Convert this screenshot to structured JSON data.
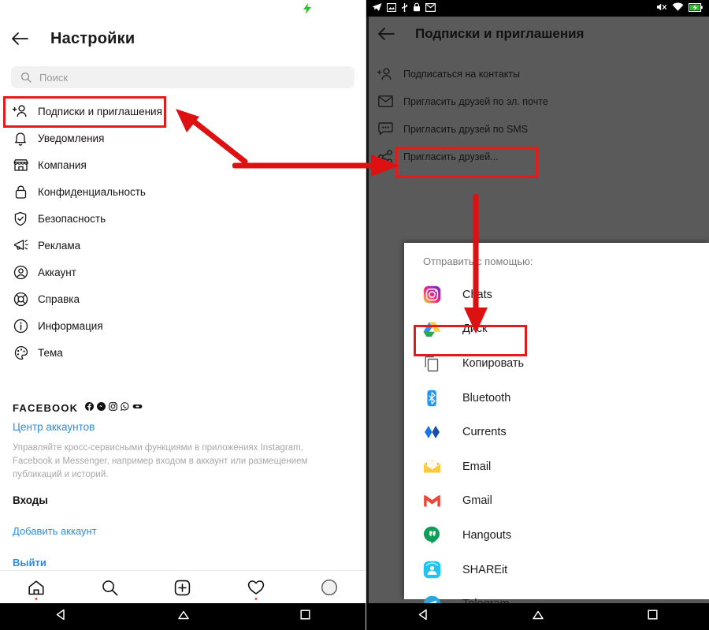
{
  "left_phone": {
    "status": {
      "charging_icon": "charging-bolt-icon"
    },
    "header": {
      "back_icon": "back-arrow-icon",
      "title": "Настройки"
    },
    "search": {
      "icon": "search-icon",
      "placeholder": "Поиск"
    },
    "menu_items": [
      {
        "icon": "follow-person-icon",
        "label": "Подписки и приглашения",
        "highlighted": true
      },
      {
        "icon": "bell-icon",
        "label": "Уведомления"
      },
      {
        "icon": "store-icon",
        "label": "Компания"
      },
      {
        "icon": "lock-icon",
        "label": "Конфиденциальность"
      },
      {
        "icon": "shield-check-icon",
        "label": "Безопасность"
      },
      {
        "icon": "megaphone-icon",
        "label": "Реклама"
      },
      {
        "icon": "account-circle-icon",
        "label": "Аккаунт"
      },
      {
        "icon": "lifebuoy-icon",
        "label": "Справка"
      },
      {
        "icon": "info-circle-icon",
        "label": "Информация"
      },
      {
        "icon": "palette-icon",
        "label": "Тема"
      }
    ],
    "facebook_section": {
      "word": "FACEBOOK",
      "brand_icons": [
        "facebook-icon",
        "messenger-icon",
        "instagram-icon",
        "whatsapp-icon",
        "oculus-icon"
      ],
      "link": "Центр аккаунтов",
      "description": "Управляйте кросс-сервисными функциями в приложениях Instagram, Facebook и Messenger, например входом в аккаунт или размещением публикаций и историй."
    },
    "logins_section": {
      "heading": "Входы",
      "add_account": "Добавить аккаунт",
      "logout": "Выйти"
    },
    "tabbar": [
      {
        "icon": "home-icon",
        "dot": true
      },
      {
        "icon": "search-icon",
        "dot": false
      },
      {
        "icon": "add-square-icon",
        "dot": false
      },
      {
        "icon": "heart-icon",
        "dot": true
      },
      {
        "icon": "avatar-icon",
        "dot": false
      }
    ],
    "navbar": [
      "back-triangle-icon",
      "home-pentagon-icon",
      "recents-square-icon"
    ]
  },
  "right_phone": {
    "status": {
      "left_icons": [
        "telegram-icon",
        "screenshot-icon",
        "usb-icon",
        "lock-icon",
        "mail-icon"
      ],
      "right_icons": [
        "mute-icon",
        "wifi-icon",
        "battery-charging-icon"
      ]
    },
    "header": {
      "back_icon": "back-arrow-icon",
      "title": "Подписки и приглашения"
    },
    "menu_items": [
      {
        "icon": "follow-person-icon",
        "label": "Подписаться на контакты",
        "highlighted": false
      },
      {
        "icon": "envelope-icon",
        "label": "Пригласить друзей по эл. почте",
        "highlighted": false
      },
      {
        "icon": "sms-bubble-icon",
        "label": "Пригласить друзей по SMS",
        "highlighted": false
      },
      {
        "icon": "share-icon",
        "label": "Пригласить друзей...",
        "highlighted": true
      }
    ],
    "share_sheet": {
      "title": "Отправить с помощью:",
      "items": [
        {
          "icon": "instagram-icon",
          "label": "Chats",
          "highlighted": false
        },
        {
          "icon": "google-drive-icon",
          "label": "Диск",
          "highlighted": false
        },
        {
          "icon": "copy-icon",
          "label": "Копировать",
          "highlighted": true
        },
        {
          "icon": "bluetooth-icon",
          "label": "Bluetooth",
          "highlighted": false
        },
        {
          "icon": "currents-icon",
          "label": "Currents",
          "highlighted": false
        },
        {
          "icon": "email-icon",
          "label": "Email",
          "highlighted": false
        },
        {
          "icon": "gmail-icon",
          "label": "Gmail",
          "highlighted": false
        },
        {
          "icon": "hangouts-icon",
          "label": "Hangouts",
          "highlighted": false
        },
        {
          "icon": "shareit-icon",
          "label": "SHAREit",
          "highlighted": false
        },
        {
          "icon": "telegram-icon",
          "label": "Telegram",
          "highlighted": false
        }
      ]
    },
    "navbar": [
      "back-triangle-icon",
      "home-pentagon-icon",
      "recents-square-icon"
    ]
  },
  "annotations": {
    "highlight_color": "#e21b1b",
    "arrows": [
      {
        "name": "arrow-to-subscriptions",
        "direction": "up-left"
      },
      {
        "name": "arrow-to-invite-friends",
        "direction": "right"
      },
      {
        "name": "arrow-to-copy",
        "direction": "down"
      }
    ]
  }
}
